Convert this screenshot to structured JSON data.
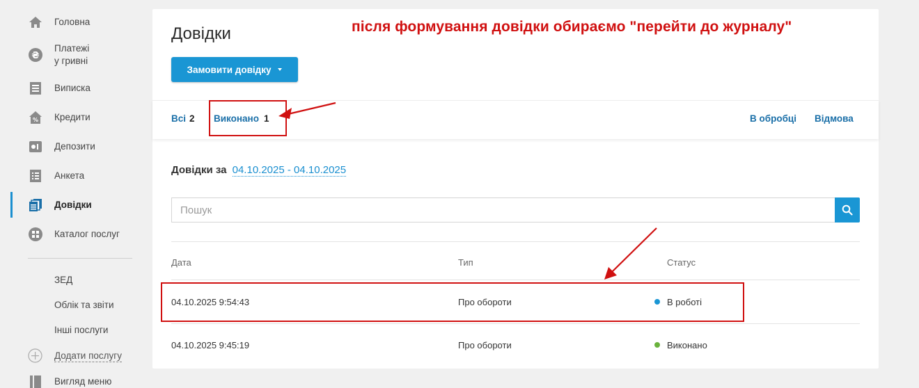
{
  "sidebar": {
    "items": [
      {
        "label": "Головна",
        "icon": "home-icon"
      },
      {
        "label": "Платежі\nу гривні",
        "line1": "Платежі",
        "line2": "у гривні",
        "icon": "hryvnia-icon"
      },
      {
        "label": "Виписка",
        "icon": "statement-icon"
      },
      {
        "label": "Кредити",
        "icon": "credit-icon"
      },
      {
        "label": "Депозити",
        "icon": "deposit-icon"
      },
      {
        "label": "Анкета",
        "icon": "form-icon"
      },
      {
        "label": "Довідки",
        "icon": "documents-icon",
        "active": true
      },
      {
        "label": "Каталог послуг",
        "icon": "catalog-icon"
      }
    ],
    "sub_items": [
      "ЗЕД",
      "Облік та звіти",
      "Інші послуги"
    ],
    "add_service": "Додати послугу",
    "view_menu": "Вигляд меню"
  },
  "main": {
    "title": "Довідки",
    "order_button": "Замовити довідку",
    "tabs": [
      {
        "label": "Всі",
        "count": "2"
      },
      {
        "label": "Виконано",
        "count": "1"
      },
      {
        "label": "В обробці"
      },
      {
        "label": "Відмова"
      }
    ],
    "period_label": "Довідки за",
    "period_dates": "04.10.2025 - 04.10.2025",
    "search_placeholder": "Пошук",
    "table": {
      "headers": [
        "Дата",
        "Тип",
        "Статус"
      ],
      "rows": [
        {
          "date": "04.10.2025 9:54:43",
          "type": "Про обороти",
          "status": "В роботі",
          "status_color": "#1a96d4"
        },
        {
          "date": "04.10.2025 9:45:19",
          "type": "Про обороти",
          "status": "Виконано",
          "status_color": "#6ab23c"
        }
      ]
    }
  },
  "annotation": {
    "note": "після формування довідки обираємо \"перейти до журналу\"",
    "color": "#d01010"
  },
  "colors": {
    "accent": "#1a96d4",
    "link": "#1a6fa8",
    "background": "#f0f0f0"
  }
}
